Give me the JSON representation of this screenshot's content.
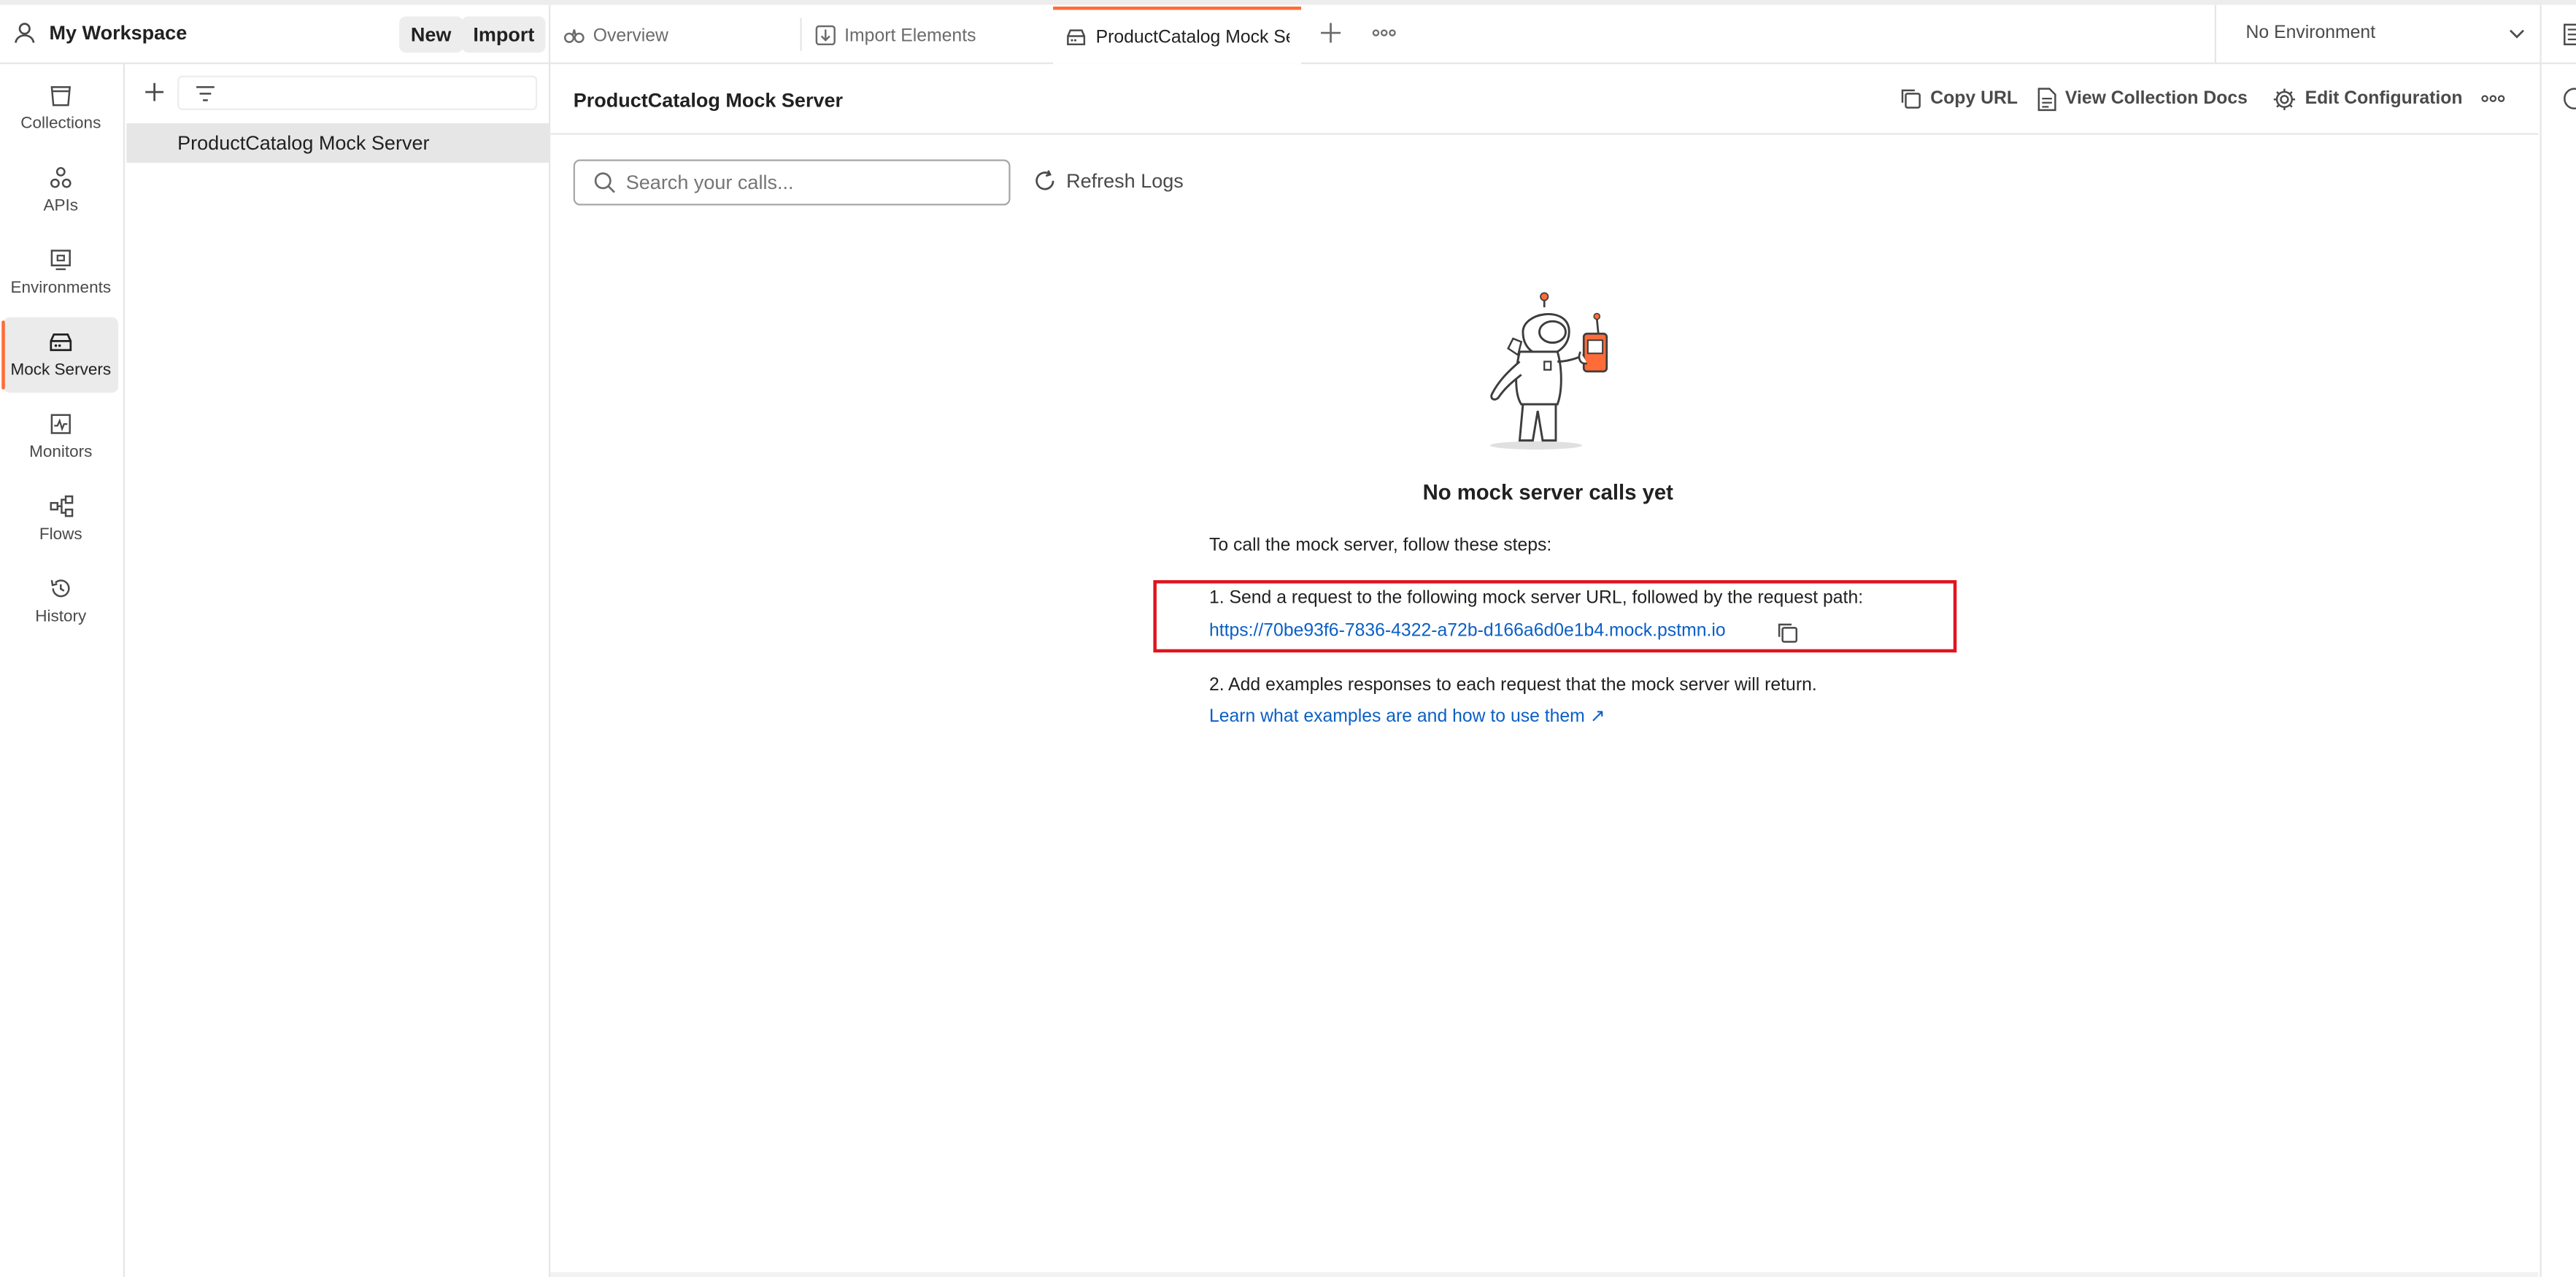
{
  "workspace": {
    "name": "My Workspace",
    "new_label": "New",
    "import_label": "Import"
  },
  "tabs": [
    {
      "label": "Overview",
      "icon": "overview-icon"
    },
    {
      "label": "Import Elements",
      "icon": "import-icon"
    },
    {
      "label": "ProductCatalog Mock Ser",
      "icon": "mock-server-icon",
      "active": true
    }
  ],
  "environment": {
    "selected": "No Environment"
  },
  "nav": {
    "items": [
      {
        "label": "Collections",
        "icon": "collections-icon"
      },
      {
        "label": "APIs",
        "icon": "apis-icon"
      },
      {
        "label": "Environments",
        "icon": "environments-icon"
      },
      {
        "label": "Mock Servers",
        "icon": "mock-servers-icon",
        "active": true
      },
      {
        "label": "Monitors",
        "icon": "monitors-icon"
      },
      {
        "label": "Flows",
        "icon": "flows-icon"
      },
      {
        "label": "History",
        "icon": "history-icon"
      }
    ]
  },
  "sidebar": {
    "items": [
      {
        "label": "ProductCatalog Mock Server",
        "selected": true
      }
    ]
  },
  "main": {
    "title": "ProductCatalog Mock Server",
    "actions": {
      "copy_url": "Copy URL",
      "view_docs": "View Collection Docs",
      "edit_config": "Edit Configuration"
    },
    "search_placeholder": "Search your calls...",
    "refresh_label": "Refresh Logs",
    "empty": {
      "heading": "No mock server calls yet",
      "intro": "To call the mock server, follow these steps:",
      "step1": "1. Send a request to the following mock server URL, followed by the request path:",
      "url": "https://70be93f6-7836-4322-a72b-d166a6d0e1b4.mock.pstmn.io",
      "step2": "2. Add examples responses to each request that the mock server will return.",
      "learn_link": "Learn what examples are and how to use them ↗"
    }
  },
  "colors": {
    "accent": "#ff6c37",
    "link": "#0b5fc5",
    "highlight_box": "#e0141e"
  }
}
